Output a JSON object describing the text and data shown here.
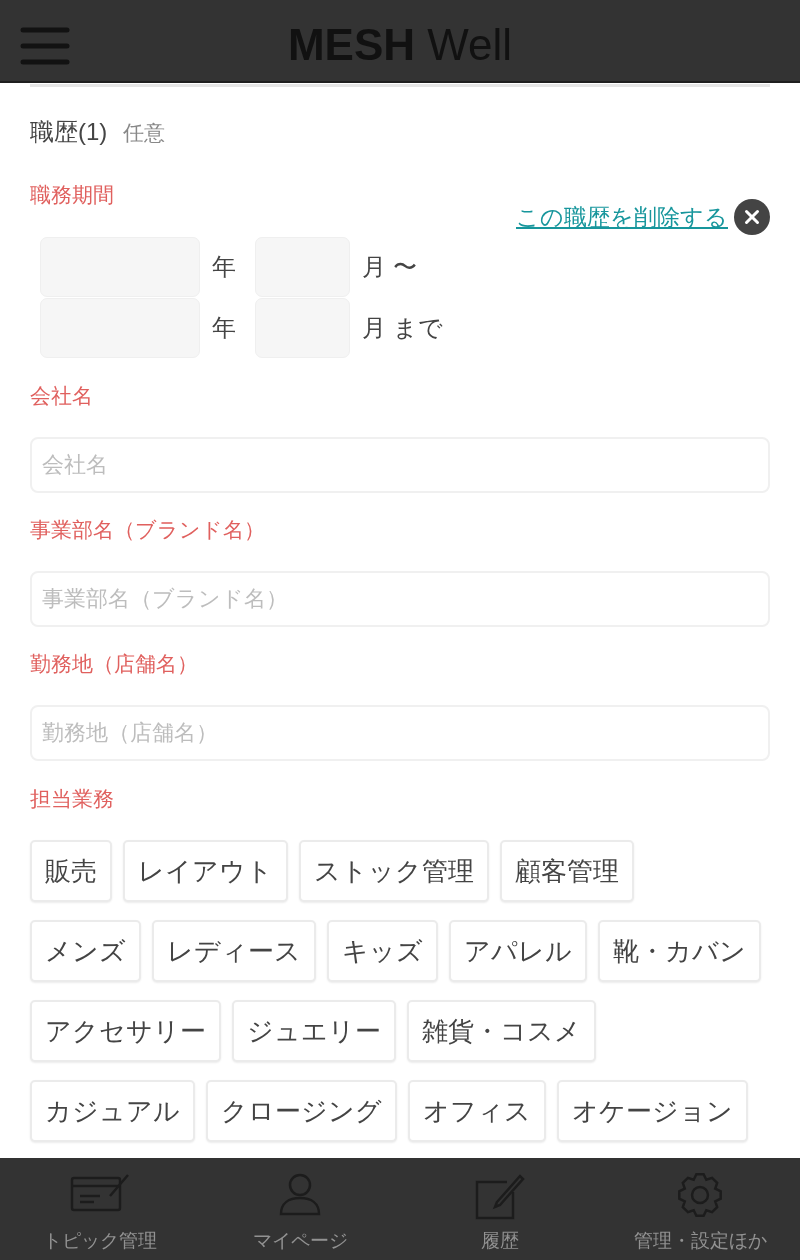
{
  "header": {
    "logo": "**MESH** Well"
  },
  "section": {
    "title": "職歴(1)",
    "badge": "任意"
  },
  "period": {
    "label": "職務期間",
    "delete_link": "この職歴を削除する",
    "rows": [
      {
        "year_unit": "年",
        "month_unit": "月 〜"
      },
      {
        "year_unit": "年",
        "month_unit": "月 まで"
      }
    ]
  },
  "fields": [
    {
      "label": "会社名",
      "placeholder": "会社名"
    },
    {
      "label": "事業部名（ブランド名）",
      "placeholder": "事業部名（ブランド名）"
    },
    {
      "label": "勤務地（店舗名）",
      "placeholder": "勤務地（店舗名）"
    }
  ],
  "duties": {
    "label": "担当業務",
    "rows": [
      [
        {
          "label": "販売",
          "selected": false
        },
        {
          "label": "レイアウト",
          "selected": false
        },
        {
          "label": "ストック管理",
          "selected": false
        },
        {
          "label": "顧客管理",
          "selected": false
        }
      ],
      [
        {
          "label": "メンズ",
          "selected": false
        },
        {
          "label": "レディース",
          "selected": false
        },
        {
          "label": "キッズ",
          "selected": false
        },
        {
          "label": "アパレル",
          "selected": false
        },
        {
          "label": "靴・カバン",
          "selected": false
        }
      ],
      [
        {
          "label": "アクセサリー",
          "selected": false
        },
        {
          "label": "ジュエリー",
          "selected": false
        },
        {
          "label": "雑貨・コスメ",
          "selected": false
        }
      ],
      [
        {
          "label": "カジュアル",
          "selected": false
        },
        {
          "label": "クロージング",
          "selected": false
        },
        {
          "label": "オフィス",
          "selected": false
        },
        {
          "label": "オケージョン",
          "selected": false
        }
      ]
    ]
  },
  "bottom_nav": [
    {
      "label": "トピック管理"
    },
    {
      "label": "マイページ"
    },
    {
      "label": "履歴"
    },
    {
      "label": "管理・設定ほか"
    }
  ]
}
